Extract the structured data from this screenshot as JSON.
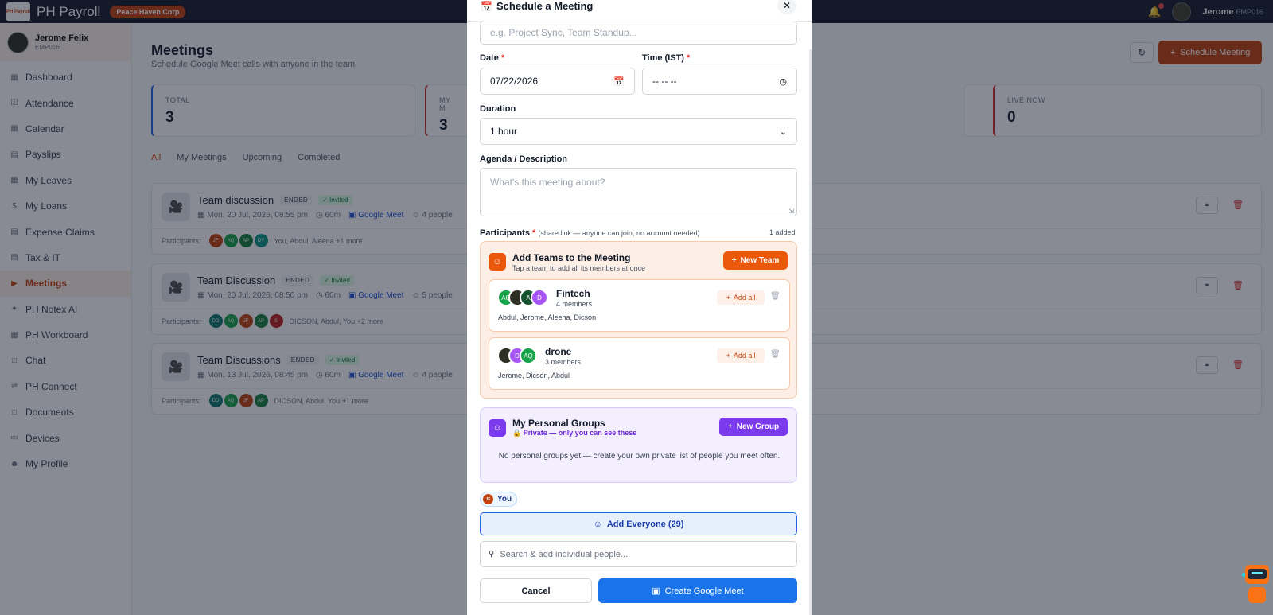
{
  "topbar": {
    "logo_text": "PH Payroll",
    "app_name": "PH Payroll",
    "org": "Peace Haven Corp",
    "user": "Jerome",
    "user_id": "EMP016"
  },
  "sidebar": {
    "user_name": "Jerome Felix",
    "user_id": "EMP016",
    "items": [
      {
        "label": "Dashboard",
        "icon": "grid-icon"
      },
      {
        "label": "Attendance",
        "icon": "clipboard-check-icon"
      },
      {
        "label": "Calendar",
        "icon": "calendar-icon"
      },
      {
        "label": "Payslips",
        "icon": "document-icon"
      },
      {
        "label": "My Leaves",
        "icon": "calendar-leave-icon"
      },
      {
        "label": "My Loans",
        "icon": "dollar-icon"
      },
      {
        "label": "Expense Claims",
        "icon": "receipt-icon"
      },
      {
        "label": "Tax & IT",
        "icon": "document-tax-icon"
      },
      {
        "label": "Meetings",
        "icon": "video-icon"
      },
      {
        "label": "PH Notex AI",
        "icon": "sparkle-icon"
      },
      {
        "label": "PH Workboard",
        "icon": "board-icon"
      },
      {
        "label": "Chat",
        "icon": "chat-icon"
      },
      {
        "label": "PH Connect",
        "icon": "connect-icon"
      },
      {
        "label": "Documents",
        "icon": "folder-icon"
      },
      {
        "label": "Devices",
        "icon": "monitor-icon"
      },
      {
        "label": "My Profile",
        "icon": "user-icon"
      }
    ],
    "active": "Meetings"
  },
  "main": {
    "title": "Meetings",
    "subtitle": "Schedule Google Meet calls with anyone in the team",
    "schedule_button": "Schedule Meeting",
    "stats": [
      {
        "label": "TOTAL",
        "value": "3"
      },
      {
        "label": "MY M",
        "value": "3"
      },
      {
        "label": "LIVE NOW",
        "value": "0"
      }
    ],
    "tabs": [
      "All",
      "My Meetings",
      "Upcoming",
      "Completed"
    ],
    "participants_label": "Participants:",
    "meetings": [
      {
        "title": "Team discussion",
        "status": "ENDED",
        "invited": "✓ Invited",
        "date": "Mon, 20 Jul, 2026, 08:55 pm",
        "duration": "60m",
        "platform": "Google Meet",
        "people": "4 people",
        "avatars": [
          {
            "t": "JF",
            "c": "#c2410c"
          },
          {
            "t": "AQ",
            "c": "#16a34a"
          },
          {
            "t": "AP",
            "c": "#15803d"
          },
          {
            "t": "DY",
            "c": "#0d9488"
          }
        ],
        "names": "You, Abdul, Aleena +1 more"
      },
      {
        "title": "Team Discussion",
        "status": "ENDED",
        "invited": "✓ Invited",
        "date": "Mon, 20 Jul, 2026, 08:50 pm",
        "duration": "60m",
        "platform": "Google Meet",
        "people": "5 people",
        "avatars": [
          {
            "t": "DD",
            "c": "#0f766e"
          },
          {
            "t": "AQ",
            "c": "#16a34a"
          },
          {
            "t": "JF",
            "c": "#c2410c"
          },
          {
            "t": "AP",
            "c": "#15803d"
          },
          {
            "t": "S",
            "c": "#b91c1c"
          }
        ],
        "names": "DICSON, Abdul, You +2 more"
      },
      {
        "title": "Team Discussions",
        "status": "ENDED",
        "invited": "✓ Invited",
        "date": "Mon, 13 Jul, 2026, 08:45 pm",
        "duration": "60m",
        "platform": "Google Meet",
        "people": "4 people",
        "avatars": [
          {
            "t": "DD",
            "c": "#0f766e"
          },
          {
            "t": "AQ",
            "c": "#16a34a"
          },
          {
            "t": "JF",
            "c": "#c2410c"
          },
          {
            "t": "AP",
            "c": "#15803d"
          }
        ],
        "names": "DICSON, Abdul, You +1 more"
      }
    ]
  },
  "modal": {
    "title": "Schedule a Meeting",
    "title_placeholder": "e.g. Project Sync, Team Standup...",
    "date_label": "Date",
    "date_value": "07/22/2026",
    "time_label": "Time (IST)",
    "time_value": "--:-- --",
    "duration_label": "Duration",
    "duration_value": "1 hour",
    "agenda_label": "Agenda / Description",
    "agenda_placeholder": "What's this meeting about?",
    "participants_label": "Participants",
    "participants_hint": "(share link — anyone can join, no account needed)",
    "added": "1 added",
    "teams": {
      "title": "Add Teams to the Meeting",
      "subtitle": "Tap a team to add all its members at once",
      "new_button": "New Team",
      "add_all": "Add all",
      "list": [
        {
          "name": "Fintech",
          "count": "4 members",
          "members": "Abdul, Jerome, Aleena, Dicson",
          "avatars": [
            {
              "t": "AQ",
              "c": "#16a34a"
            },
            {
              "t": "",
              "c": "#2d2f22"
            },
            {
              "t": "A",
              "c": "#14532d"
            },
            {
              "t": "D",
              "c": "#a855f7"
            }
          ]
        },
        {
          "name": "drone",
          "count": "3 members",
          "members": "Jerome, Dicson, Abdul",
          "avatars": [
            {
              "t": "",
              "c": "#2d2f22"
            },
            {
              "t": "D",
              "c": "#a855f7"
            },
            {
              "t": "AQ",
              "c": "#16a34a"
            }
          ]
        }
      ]
    },
    "groups": {
      "title": "My Personal Groups",
      "private": "🔒 Private — only you can see these",
      "new_button": "New Group",
      "empty": "No personal groups yet — create your own private list of people you meet often."
    },
    "you_chip_initials": "JF",
    "you_chip": "You",
    "add_everyone": "Add Everyone (29)",
    "search_placeholder": "Search & add individual people...",
    "cancel": "Cancel",
    "create": "Create Google Meet"
  },
  "colors": {
    "accent": "#c2410c",
    "google_blue": "#1a73e8",
    "purple": "#7c3aed"
  }
}
